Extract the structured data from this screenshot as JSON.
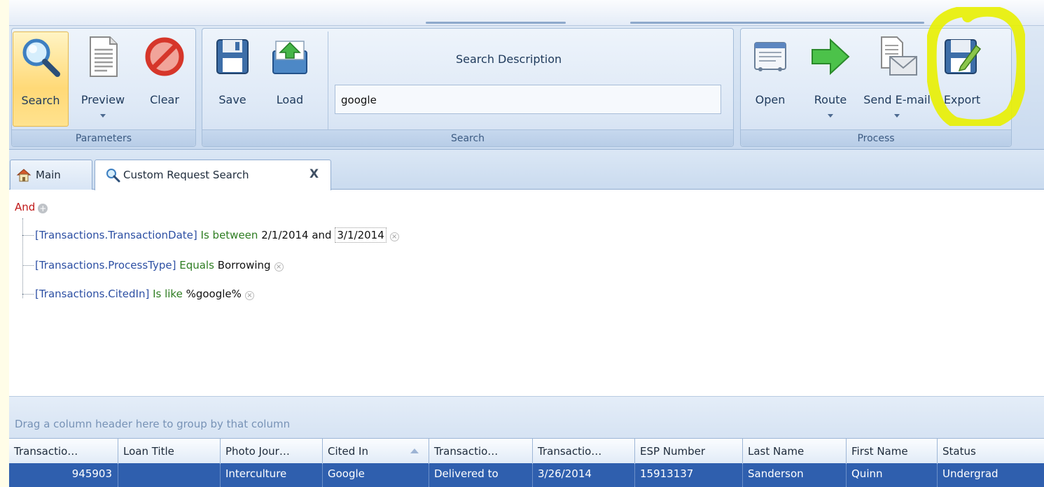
{
  "ribbon": {
    "parameters": {
      "label": "Parameters",
      "search": "Search",
      "preview": "Preview",
      "clear": "Clear"
    },
    "search_group": {
      "label": "Search",
      "save": "Save",
      "load": "Load",
      "description_label": "Search Description",
      "description_value": "google"
    },
    "process": {
      "label": "Process",
      "open": "Open",
      "route": "Route",
      "send_email": "Send E-mail",
      "export": "Export"
    }
  },
  "tabs": [
    {
      "label": "Main",
      "icon": "home-icon"
    },
    {
      "label": "Custom Request Search",
      "icon": "search-icon",
      "close": "X"
    }
  ],
  "filter": {
    "operator": "And",
    "conditions": [
      {
        "field": "[Transactions.TransactionDate]",
        "op": "Is between",
        "value1": "2/1/2014",
        "joiner": "and",
        "value2": "3/1/2014"
      },
      {
        "field": "[Transactions.ProcessType]",
        "op": "Equals",
        "value": "Borrowing"
      },
      {
        "field": "[Transactions.CitedIn]",
        "op": "Is like",
        "value": "%google%"
      }
    ]
  },
  "grid": {
    "group_hint": "Drag a column header here to group by that column",
    "columns": [
      "Transactio…",
      "Loan Title",
      "Photo Jour…",
      "Cited In",
      "Transactio…",
      "Transactio…",
      "ESP Number",
      "Last Name",
      "First Name",
      "Status"
    ],
    "sorted_column": "Cited In",
    "first_row": [
      "945903",
      "",
      "Interculture",
      "Google",
      "Delivered to",
      "3/26/2014",
      "15913137",
      "Sanderson",
      "Quinn",
      "Undergrad"
    ]
  },
  "colors": {
    "ribbon_bg": "#c9daef",
    "active_button": "#ffd977",
    "selected_row": "#2f5fae",
    "highlight_marker": "#e8f000",
    "and_operator": "#c01818",
    "condition_field": "#2c4fa3",
    "condition_operator": "#2e7d22"
  }
}
